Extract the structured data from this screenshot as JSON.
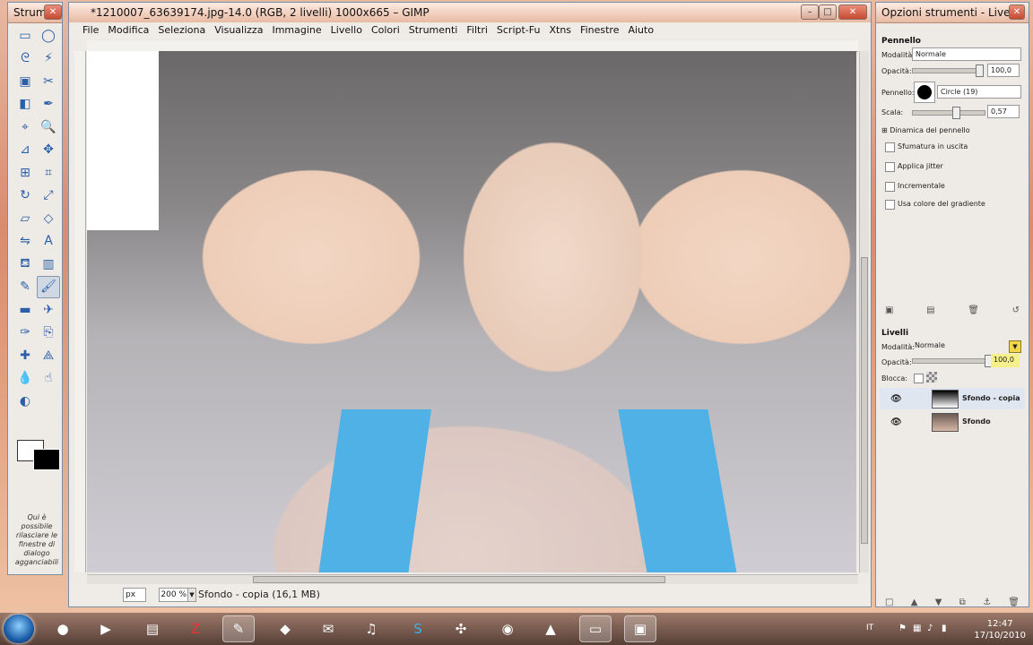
{
  "toolbox": {
    "title": "Strume...",
    "hint": "Qui è possibile rilasciare le finestre di dialogo agganciabili",
    "tools": [
      "rect-select-icon",
      "ellipse-select-icon",
      "lasso-icon",
      "magic-wand-icon",
      "select-by-color-icon",
      "scissors-icon",
      "foreground-select-icon",
      "paths-icon",
      "color-picker-icon",
      "zoom-icon",
      "measure-icon",
      "move-icon",
      "align-icon",
      "crop-icon",
      "rotate-icon",
      "scale-icon",
      "shear-icon",
      "perspective-icon",
      "flip-icon",
      "text-icon",
      "bucket-fill-icon",
      "gradient-icon",
      "pencil-icon",
      "paintbrush-icon",
      "eraser-icon",
      "airbrush-icon",
      "ink-icon",
      "clone-icon",
      "heal-icon",
      "perspective-clone-icon",
      "blur-icon",
      "smudge-icon",
      "dodge-burn-icon"
    ]
  },
  "main": {
    "title": "*1210007_63639174.jpg-14.0 (RGB, 2 livelli) 1000x665 – GIMP",
    "menu": [
      "File",
      "Modifica",
      "Seleziona",
      "Visualizza",
      "Immagine",
      "Livello",
      "Colori",
      "Strumenti",
      "Filtri",
      "Script-Fu",
      "Xtns",
      "Finestre",
      "Aiuto"
    ],
    "status": {
      "unit": "px",
      "zoom": "200 %",
      "info": "Sfondo - copia (16,1 MB)"
    }
  },
  "dock": {
    "title": "Opzioni strumenti - Livelli",
    "tool_options": {
      "section": "Pennello",
      "mode_label": "Modalità:",
      "mode_value": "Normale",
      "opacity_label": "Opacità:",
      "opacity_value": "100,0",
      "brush_label": "Pennello:",
      "brush_value": "Circle (19)",
      "scale_label": "Scala:",
      "scale_value": "0,57",
      "dynamics": "Dinamica del pennello",
      "options": [
        "Sfumatura in uscita",
        "Applica jitter",
        "Incrementale",
        "Usa colore del gradiente"
      ]
    },
    "layers": {
      "section": "Livelli",
      "mode_label": "Modalità:",
      "mode_value": "Normale",
      "opacity_label": "Opacità:",
      "opacity_value": "100,0",
      "lock_label": "Blocca:",
      "items": [
        "Sfondo - copia",
        "Sfondo"
      ]
    }
  },
  "taskbar": {
    "lang": "IT",
    "time": "12:47",
    "date": "17/10/2010"
  }
}
